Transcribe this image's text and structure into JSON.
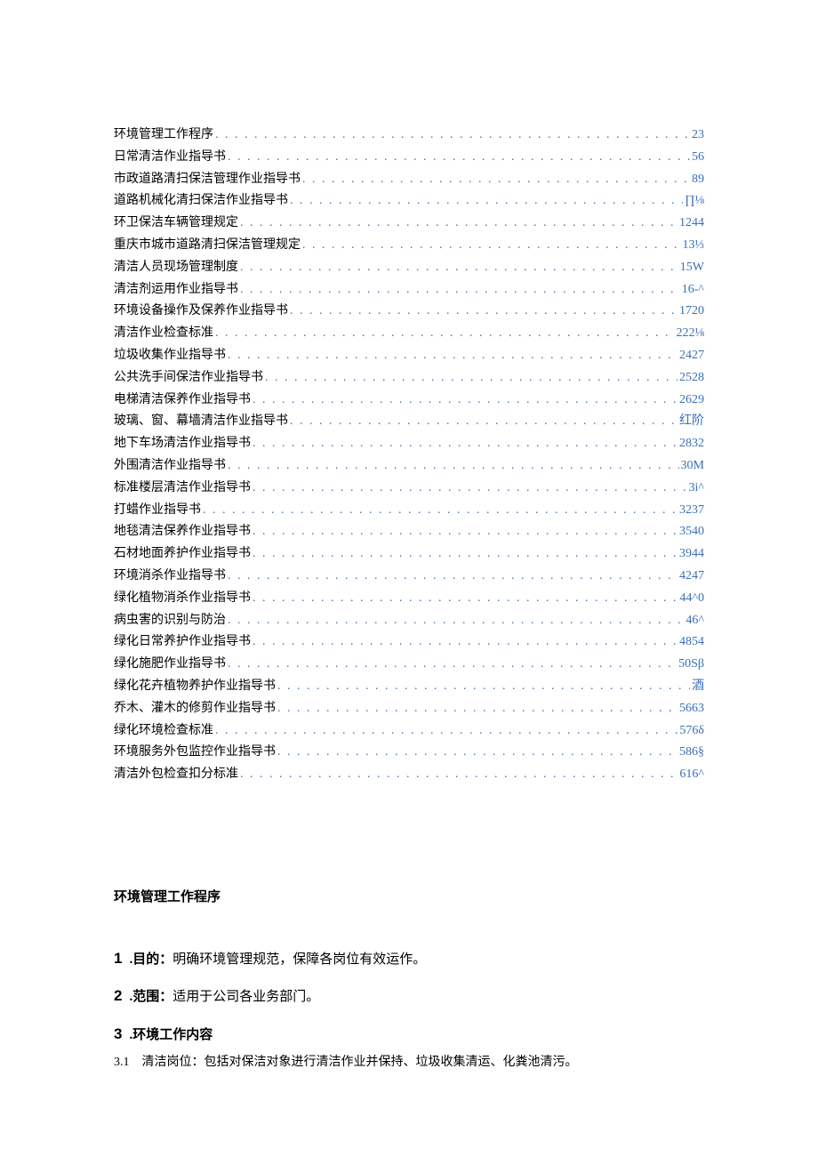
{
  "toc": {
    "dots": ". . . . . . . . . . . . . . . . . . . . . . . . . . . . . . . . . . . . . . . . . . . . . . . . . . . . . . . . . . . . . . . . . . . . . . . . . . . . . . . . . . . . . . . . . . . . . . . . . . . . . . . . . . . . . . . . . . . . . . . .",
    "entries": [
      {
        "title": "环境管理工作程序",
        "page": "23"
      },
      {
        "title": "日常清洁作业指导书",
        "page": "56"
      },
      {
        "title": "市政道路清扫保洁管理作业指导书",
        "page": "89"
      },
      {
        "title": "道路机械化清扫保洁作业指导书",
        "page": "∏⅛"
      },
      {
        "title": "环卫保洁车辆管理规定",
        "page": "1244"
      },
      {
        "title": "重庆市城市道路清扫保洁管理规定",
        "page": "13⅓"
      },
      {
        "title": "清洁人员现场管理制度",
        "page": "15W"
      },
      {
        "title": "清洁剂运用作业指导书",
        "page": "16-^"
      },
      {
        "title": "环境设备操作及保养作业指导书",
        "page": "1720"
      },
      {
        "title": "清洁作业检查标准",
        "page": "222⅛"
      },
      {
        "title": "垃圾收集作业指导书",
        "page": "2427"
      },
      {
        "title": "公共洗手间保洁作业指导书",
        "page": "2528"
      },
      {
        "title": "电梯清洁保养作业指导书",
        "page": "2629"
      },
      {
        "title": "玻璃、窗、幕墙清洁作业指导书",
        "page": "红阶"
      },
      {
        "title": "地下车场清洁作业指导书",
        "page": "2832"
      },
      {
        "title": "外围清洁作业指导书",
        "page": "30M"
      },
      {
        "title": "标准楼层清洁作业指导书",
        "page": "3i^"
      },
      {
        "title": "打蜡作业指导书",
        "page": "3237"
      },
      {
        "title": "地毯清洁保养作业指导书",
        "page": "3540"
      },
      {
        "title": "石材地面养护作业指导书",
        "page": "3944"
      },
      {
        "title": "环境消杀作业指导书",
        "page": "4247"
      },
      {
        "title": "绿化植物消杀作业指导书",
        "page": "44^0"
      },
      {
        "title": "病虫害的识别与防治",
        "page": "46^"
      },
      {
        "title": "绿化日常养护作业指导书",
        "page": "4854"
      },
      {
        "title": "绿化施肥作业指导书",
        "page": "50Sβ"
      },
      {
        "title": "绿化花卉植物养护作业指导书",
        "page": "酒"
      },
      {
        "title": "乔木、灌木的修剪作业指导书",
        "page": "5663"
      },
      {
        "title": "绿化环境检查标准",
        "page": "576δ"
      },
      {
        "title": "环境服务外包监控作业指导书",
        "page": "586§"
      },
      {
        "title": "清洁外包检查扣分标准",
        "page": "616^"
      }
    ]
  },
  "body": {
    "heading": "环境管理工作程序",
    "items": [
      {
        "num": "1",
        "label": ".目的：",
        "bold": true,
        "text": "明确环境管理规范，保障各岗位有效运作。"
      },
      {
        "num": "2",
        "label": ".范围：",
        "bold": true,
        "text": "适用于公司各业务部门。"
      },
      {
        "num": "3",
        "label": ".环境工作内容",
        "bold": true,
        "text": ""
      }
    ],
    "sub": {
      "num": "3.1",
      "text": "清洁岗位：包括对保洁对象进行清洁作业并保持、垃圾收集清运、化粪池清污。"
    }
  }
}
